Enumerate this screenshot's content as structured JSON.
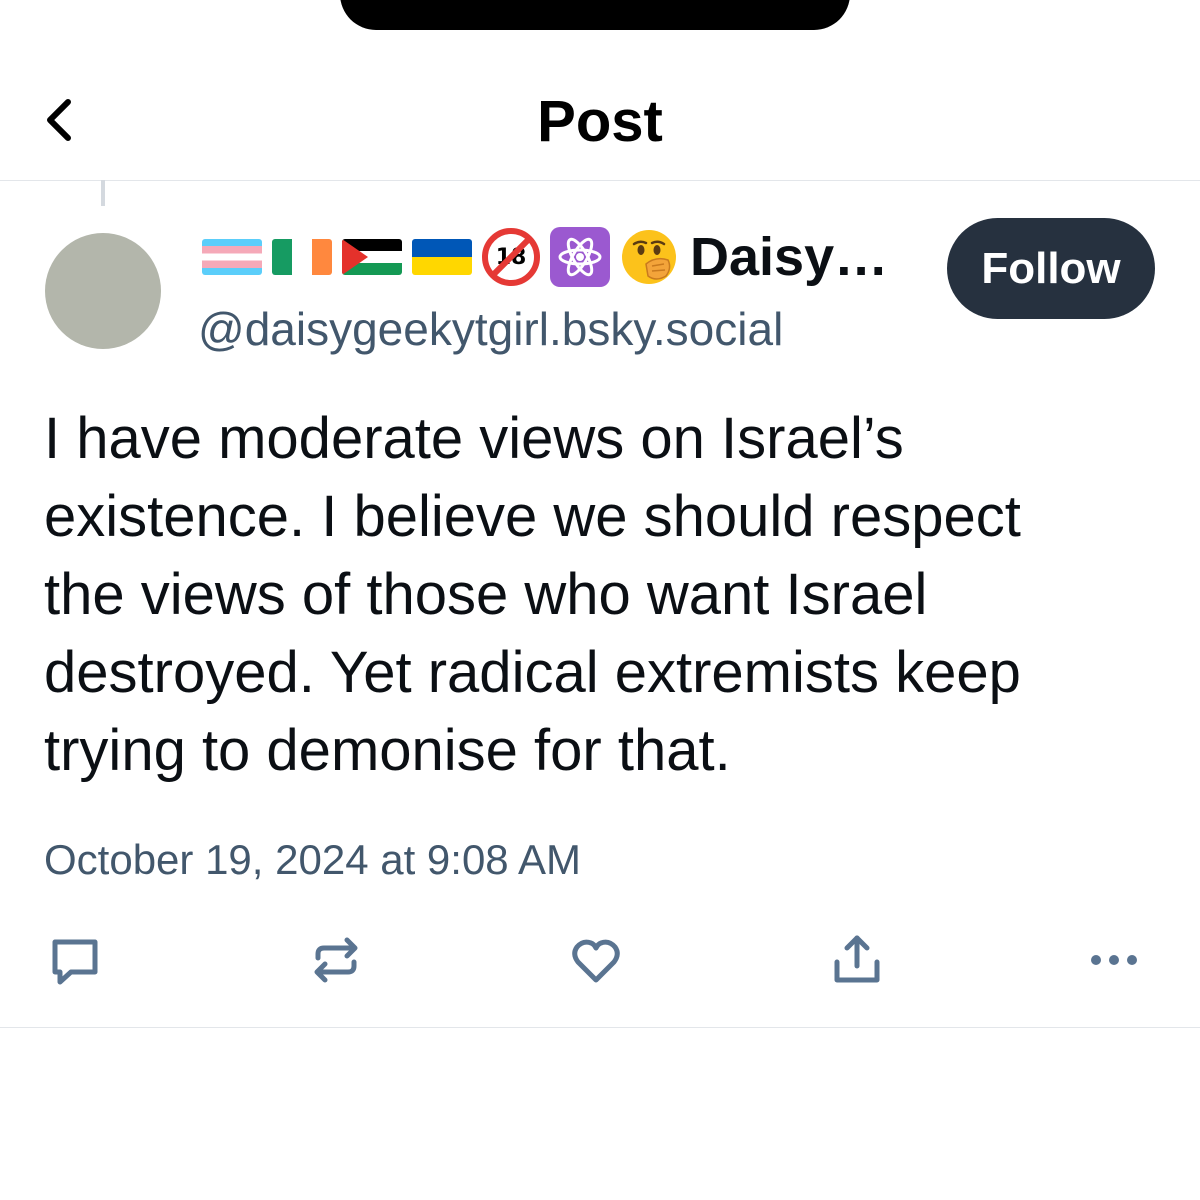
{
  "header": {
    "title": "Post",
    "back_icon": "chevron-left-icon"
  },
  "author": {
    "display_name": "Daisy…",
    "name_emojis": [
      "transgender-flag",
      "ireland-flag",
      "palestine-flag",
      "ukraine-flag",
      "no-one-under-eighteen",
      "atom-symbol",
      "face-with-open-eyes-and-hand-over-mouth"
    ],
    "no18_text": "18",
    "handle": "@daisygeekytgirl.bsky.social",
    "avatar_color": "#b3b6ab"
  },
  "follow_button": {
    "label": "Follow",
    "bg_color": "#26313f"
  },
  "post": {
    "text": "I have moderate views on Israel’s\nexistence. I believe we should respect\nthe views of those who want Israel\ndestroyed. Yet radical extremists keep\ntrying to demonise for that.",
    "timestamp": "October 19, 2024 at 9:08 AM"
  },
  "actions": {
    "icons": [
      "reply-icon",
      "repost-icon",
      "like-icon",
      "share-icon",
      "more-icon"
    ],
    "icon_color": "#5a7491"
  },
  "colors": {
    "text": "#0b0f14",
    "muted": "#42576c",
    "divider": "#e3e6ea"
  }
}
